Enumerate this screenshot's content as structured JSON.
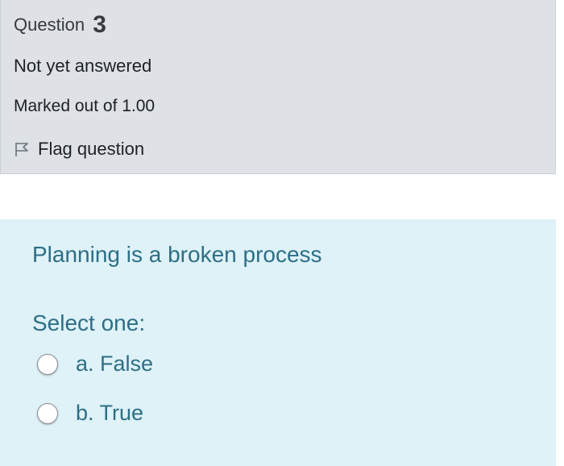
{
  "question": {
    "label": "Question",
    "number": "3",
    "state": "Not yet answered",
    "grade": "Marked out of 1.00",
    "flag_label": "Flag question",
    "flag_icon": "flag-outline-icon"
  },
  "content": {
    "question_text": "Planning is a broken process",
    "prompt": "Select one:",
    "options": [
      {
        "label": "a. False",
        "selected": false
      },
      {
        "label": "b. True",
        "selected": false
      }
    ]
  },
  "colors": {
    "info_background": "#dee2e6",
    "content_background": "#def2f8",
    "content_text": "#2e6e86"
  }
}
